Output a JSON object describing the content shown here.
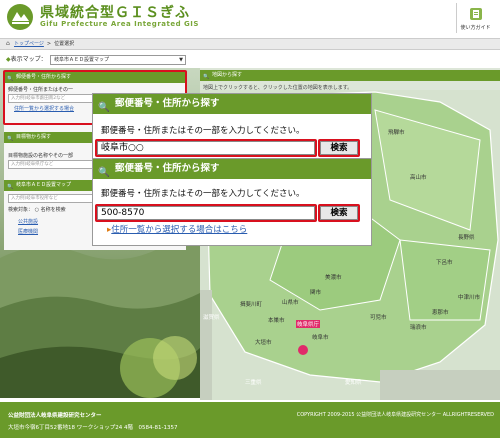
{
  "header": {
    "title": "県域統合型ＧＩＳぎふ",
    "subtitle": "Gifu Prefecture Area Integrated GIS",
    "help_label": "使い方ガイド"
  },
  "breadcrumb": {
    "home": "トップページ",
    "separator": ">",
    "current": "位置選択"
  },
  "map_select": {
    "label": "表示マップ：",
    "value": "岐阜市ＡＥＤ設置マップ"
  },
  "left": {
    "postal_panel": {
      "title": "郵便番号・住所から探す",
      "hint": "郵便番号・住所またはその一",
      "placeholder": "入力例)岐阜市薮田南2など",
      "link": "住所一覧から選択する場合"
    },
    "facility_panel": {
      "title": "目標物から探す",
      "hint": "目標物施設の名称やその一部",
      "placeholder": "入力例)岐阜県庁など"
    },
    "aed_panel": {
      "title": "岐阜市ＡＥＤ設置マップ",
      "placeholder": "入力例)岐阜市役所など",
      "search_target": "検索対象：",
      "radio_name": "名称を検索",
      "categories": [
        "公共施設",
        "医療機関"
      ]
    }
  },
  "map_panel": {
    "title": "地図から探す",
    "hint": "地図上でクリックすると、クリックした位置の地図を表示します。",
    "labels": [
      "飛騨市",
      "高山市",
      "下呂市",
      "長野県",
      "郡上市",
      "関市",
      "美濃市",
      "可児市",
      "瑞浪市",
      "恵那市",
      "中津川市",
      "岐阜県庁",
      "岐阜市",
      "大垣市",
      "愛知県",
      "滋賀県",
      "三重県",
      "山県市",
      "本巣市",
      "揖斐川町"
    ]
  },
  "popup1": {
    "title": "郵便番号・住所から探す",
    "hint": "郵便番号・住所またはその一部を入力してください。",
    "input_value": "岐阜市○○",
    "button": "検索"
  },
  "popup2": {
    "title": "郵便番号・住所から探す",
    "hint": "郵便番号・住所またはその一部を入力してください。",
    "input_value": "500-8570",
    "button": "検索",
    "link": "住所一覧から選択する場合はこちら"
  },
  "footer": {
    "org": "公益財団法人岐阜県建設研究センター",
    "address": "大垣市今宿6丁目52番地18 ワークショップ24 4階　0584-81-1357",
    "copyright": "COPYRIGHT 2009-2015 公益財団法人岐阜県建設研究センター ALLRIGHTRESERVED"
  },
  "colors": {
    "brand_green": "#6a9a2a",
    "highlight_red": "#d8101e",
    "link_blue": "#2a5db0"
  }
}
